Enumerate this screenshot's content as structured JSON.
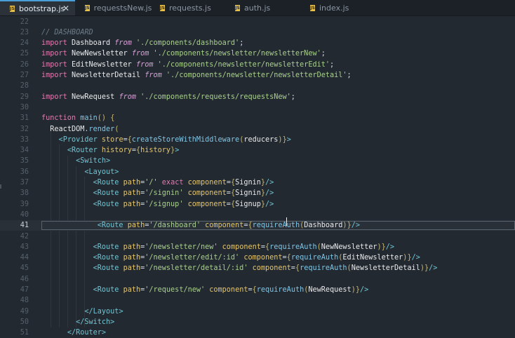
{
  "tabs": [
    {
      "label": "bootstrap.js",
      "active": true,
      "close": "✕"
    },
    {
      "label": "requestsNew.js",
      "active": false
    },
    {
      "label": "requests.js",
      "active": false
    },
    {
      "label": "auth.js",
      "active": false
    },
    {
      "label": "index.js",
      "active": false
    }
  ],
  "icons": {
    "file": "js-file-icon",
    "close": "close-icon"
  },
  "colors": {
    "background": "#232930",
    "keyword": "#e07cb0",
    "string": "#a8d18c",
    "tag": "#6fc6d6",
    "attribute": "#e6c66b",
    "function": "#7ec6e8"
  },
  "editor": {
    "current_line": "41",
    "lines": [
      {
        "n": "22",
        "code": ""
      },
      {
        "n": "23",
        "code": "// DASHBOARD"
      },
      {
        "n": "24",
        "code": "import Dashboard from './components/dashboard';"
      },
      {
        "n": "25",
        "code": "import NewNewsletter from './components/newsletter/newsletterNew';"
      },
      {
        "n": "26",
        "code": "import EditNewsletter from './components/newsletter/newsletterEdit';"
      },
      {
        "n": "27",
        "code": "import NewsletterDetail from './components/newsletter/newsletterDetail';"
      },
      {
        "n": "28",
        "code": ""
      },
      {
        "n": "29",
        "code": "import NewRequest from './components/requests/requestsNew';"
      },
      {
        "n": "30",
        "code": ""
      },
      {
        "n": "31",
        "code": "function main() {"
      },
      {
        "n": "32",
        "code": "  ReactDOM.render("
      },
      {
        "n": "33",
        "code": "    <Provider store={createStoreWithMiddleware(reducers)}>"
      },
      {
        "n": "34",
        "code": "      <Router history={history}>"
      },
      {
        "n": "35",
        "code": "        <Switch>"
      },
      {
        "n": "36",
        "code": "          <Layout>"
      },
      {
        "n": "37",
        "code": "            <Route path='/' exact component={Signin}/>"
      },
      {
        "n": "38",
        "code": "            <Route path='/signin' component={Signin}/>"
      },
      {
        "n": "39",
        "code": "            <Route path='/signup' component={Signup}/>"
      },
      {
        "n": "40",
        "code": ""
      },
      {
        "n": "41",
        "code": "             <Route path='/dashboard' component={requireAuth(Dashboard)}/>"
      },
      {
        "n": "42",
        "code": ""
      },
      {
        "n": "43",
        "code": "            <Route path='/newsletter/new' component={requireAuth(NewNewsletter)}/>"
      },
      {
        "n": "44",
        "code": "            <Route path='/newsletter/edit/:id' component={requireAuth(EditNewsletter)}/>"
      },
      {
        "n": "45",
        "code": "            <Route path='/newsletter/detail/:id' component={requireAuth(NewsletterDetail)}/>"
      },
      {
        "n": "46",
        "code": ""
      },
      {
        "n": "47",
        "code": "            <Route path='/request/new' component={requireAuth(NewRequest)}/>"
      },
      {
        "n": "48",
        "code": ""
      },
      {
        "n": "49",
        "code": "          </Layout>"
      },
      {
        "n": "50",
        "code": "        </Switch>"
      },
      {
        "n": "51",
        "code": "      </Router>"
      }
    ]
  }
}
